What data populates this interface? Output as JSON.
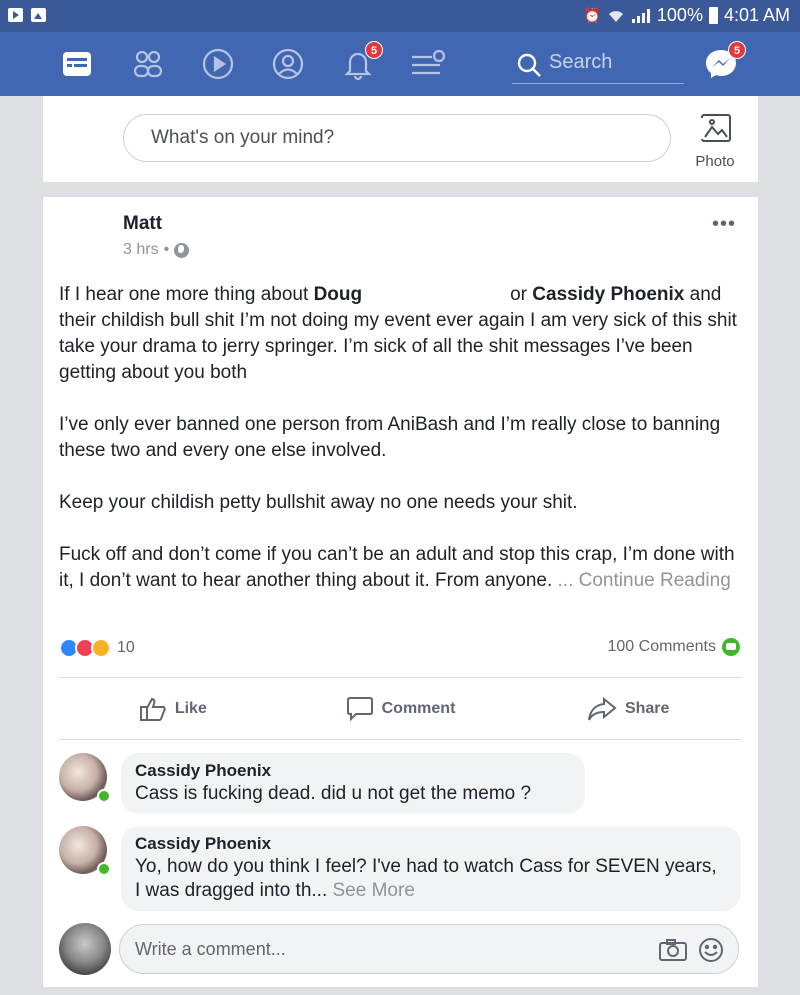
{
  "status_bar": {
    "battery": "100%",
    "time": "4:01 AM"
  },
  "nav": {
    "notifications_badge": "5",
    "messages_badge": "5",
    "search_placeholder": "Search"
  },
  "composer": {
    "placeholder": "What's on your mind?",
    "photo_label": "Photo"
  },
  "post": {
    "author": "Matt",
    "time": "3 hrs",
    "dot": "•",
    "more": "•••",
    "p1": {
      "a": "If I hear one more thing about ",
      "name1": "Doug",
      "b": "or ",
      "name2": "Cassidy Phoenix",
      "c": " and their childish bull shit I’m not doing my event ever again I am very sick of this shit  take your drama to jerry springer. I’m sick of all the shit messages I’ve been getting about you both"
    },
    "p2": "I’ve only ever banned one person from AniBash and I’m really close to banning these two and every one else involved.",
    "p3": "Keep your childish petty bullshit away no one needs your shit.",
    "p4": "Fuck off and don’t come if you can’t be an adult and stop this crap, I’m done with it, I don’t want to hear another thing about it.  From anyone. ",
    "continue": "... Continue Reading",
    "reaction_count": "10",
    "comments_count": "100 Comments",
    "actions": {
      "like": "Like",
      "comment": "Comment",
      "share": "Share"
    }
  },
  "comments": [
    {
      "name": "Cassidy Phoenix",
      "text": "Cass is fucking dead. did u not get the memo ?"
    },
    {
      "name": "Cassidy Phoenix",
      "text": "Yo, how do you think I feel? I've had to watch Cass for SEVEN years, I was dragged into th...",
      "see_more": " See More"
    }
  ],
  "write_comment": {
    "placeholder": "Write a comment..."
  },
  "colors": {
    "header": "#4267b2",
    "status_bar": "#3b5998",
    "badge": "#e0393e",
    "online": "#42b72a"
  }
}
